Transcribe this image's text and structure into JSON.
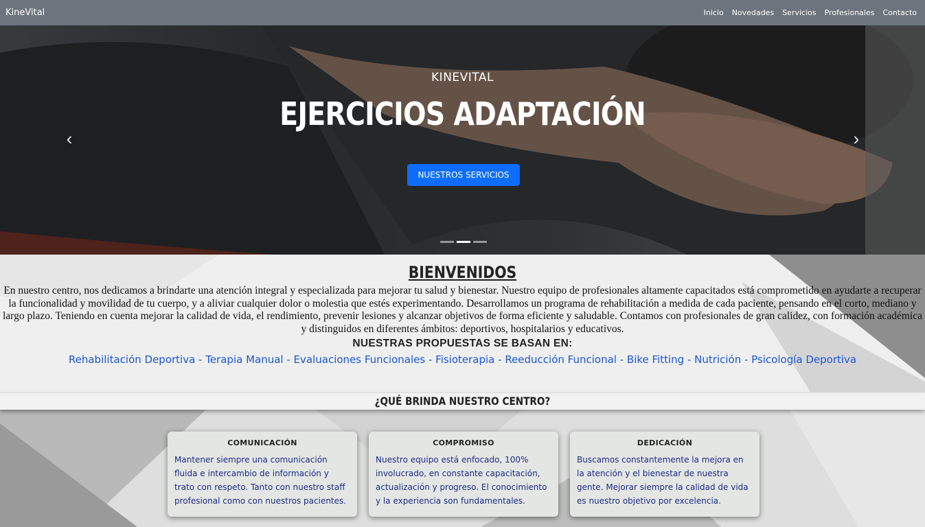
{
  "navbar": {
    "brand": "KineVital",
    "links": [
      "Inicio",
      "Novedades",
      "Servicios",
      "Profesionales",
      "Contacto"
    ]
  },
  "hero": {
    "kicker": "KINEVITAL",
    "title": "EJERCICIOS ADAPTACIÓN",
    "button_label": "NUESTROS SERVICIOS",
    "prev_icon": "‹",
    "next_icon": "›",
    "slide_count": 3,
    "active_slide": 2
  },
  "welcome": {
    "title": "BIENVENIDOS",
    "paragraph": "En nuestro centro, nos dedicamos a brindarte una atención integral y especializada para mejorar tu salud y bienestar. Nuestro equipo de profesionales altamente capacitados está comprometido en ayudarte a recuperar la funcionalidad y movilidad de tu cuerpo, y a aliviar cualquier dolor o molestia que estés experimentando. Desarrollamos un programa de rehabilitación a medida de cada paciente, pensando en el corto, mediano y largo plazo. Teniendo en cuenta mejorar la calidad de vida, el rendimiento, prevenir lesiones y alcanzar objetivos de forma eficiente y saludable. Contamos con profesionales de gran calidez, con formación académica y distinguidos en diferentes ámbitos: deportivos, hospitalarios y educativos.",
    "propuestas_title": "NUESTRAS PROPUESTAS SE BASAN EN:",
    "propuestas": [
      "Rehabilitación Deportiva",
      "Terapia Manual",
      "Evaluaciones Funcionales",
      "Fisioterapia",
      "Reeducción Funcional",
      "Bike Fitting",
      "Nutrición",
      "Psicología Deportiva"
    ],
    "separator": " - "
  },
  "brinda": {
    "title": "¿QUÉ BRINDA NUESTRO CENTRO?",
    "cards": [
      {
        "title": "COMUNICACIÓN",
        "text": "Mantener siempre una comunicación fluida e intercambio de información y trato con respeto. Tanto con nuestro staff profesional como con nuestros pacientes."
      },
      {
        "title": "COMPROMISO",
        "text": "Nuestro equipo está enfocado, 100% involucrado, en constante capacitación, actualización y progreso. El conocimiento y la experiencia son fundamentales."
      },
      {
        "title": "DEDICACIÓN",
        "text": "Buscamos constantemente la mejora en la atención y el bienestar de nuestra gente. Mejorar siempre la calidad de vida es nuestro objetivo por excelencia."
      }
    ]
  },
  "colors": {
    "navbar": "#6c757d",
    "primary_button": "#0d6efd",
    "link_blue": "#1a56d6",
    "card_text": "#1c2b86"
  }
}
